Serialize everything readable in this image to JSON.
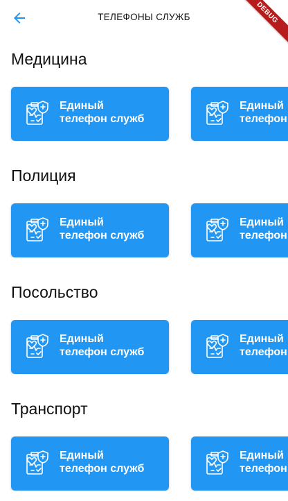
{
  "appbar": {
    "title": "ТЕЛЕФОНЫ СЛУЖБ",
    "debug_banner": "DEBUG"
  },
  "sections": [
    {
      "title": "Медицина",
      "cards": [
        {
          "label": "Единый\nтелефон служб",
          "icon": "medical-clipboard-icon"
        },
        {
          "label": "Единый\nтелефон служб",
          "icon": "medical-clipboard-icon"
        }
      ]
    },
    {
      "title": "Полиция",
      "cards": [
        {
          "label": "Единый\nтелефон служб",
          "icon": "medical-clipboard-icon"
        },
        {
          "label": "Единый\nтелефон служб",
          "icon": "medical-clipboard-icon"
        }
      ]
    },
    {
      "title": "Посольство",
      "cards": [
        {
          "label": "Единый\nтелефон служб",
          "icon": "medical-clipboard-icon"
        },
        {
          "label": "Единый\nтелефон служб",
          "icon": "medical-clipboard-icon"
        }
      ]
    },
    {
      "title": "Транспорт",
      "cards": [
        {
          "label": "Единый\nтелефон служб",
          "icon": "medical-clipboard-icon"
        },
        {
          "label": "Единый\nтелефон служб",
          "icon": "medical-clipboard-icon"
        }
      ]
    }
  ],
  "colors": {
    "accent": "#2196f3",
    "debug_banner": "#b71c1c"
  }
}
